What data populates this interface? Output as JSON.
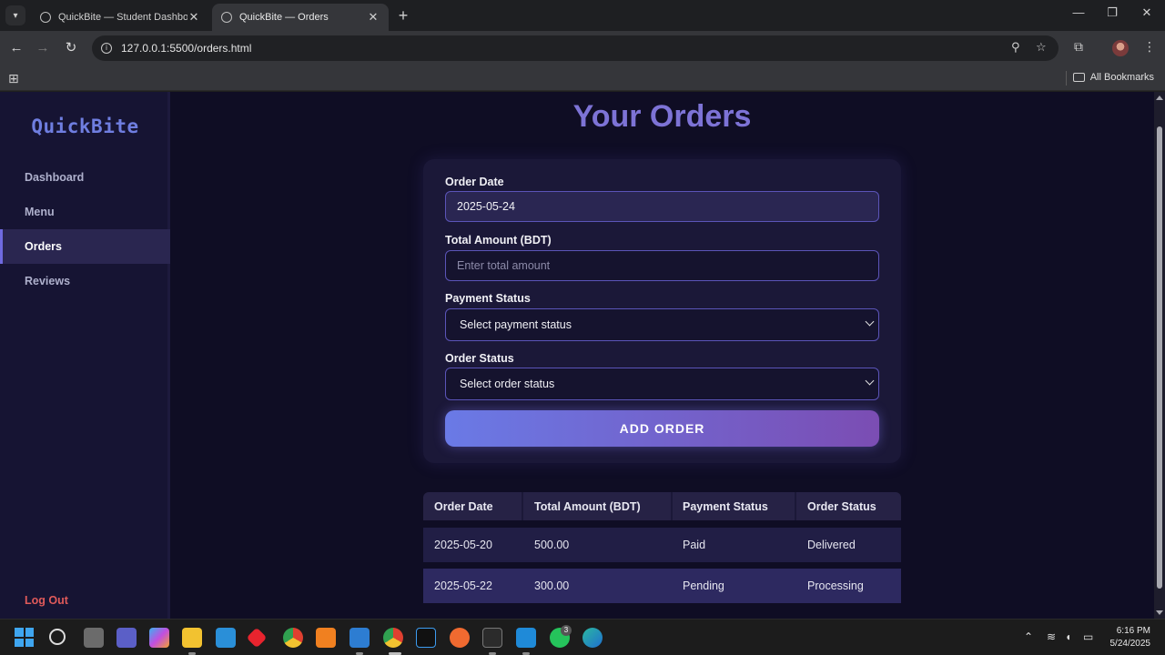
{
  "browser": {
    "tabs": [
      {
        "title": "QuickBite — Student Dashboard",
        "active": false
      },
      {
        "title": "QuickBite — Orders",
        "active": true
      }
    ],
    "url": "127.0.0.1:5500/orders.html",
    "bookmarks_label": "All Bookmarks"
  },
  "sidebar": {
    "brand": "QuickBite",
    "items": [
      {
        "label": "Dashboard",
        "active": false
      },
      {
        "label": "Menu",
        "active": false
      },
      {
        "label": "Orders",
        "active": true
      },
      {
        "label": "Reviews",
        "active": false
      }
    ],
    "logout": "Log Out"
  },
  "main": {
    "title": "Your Orders",
    "form": {
      "order_date_label": "Order Date",
      "order_date_value": "2025-05-24",
      "amount_label": "Total Amount (BDT)",
      "amount_placeholder": "Enter total amount",
      "payment_label": "Payment Status",
      "payment_selected": "Select payment status",
      "order_status_label": "Order Status",
      "order_status_selected": "Select order status",
      "submit_label": "ADD ORDER"
    },
    "table": {
      "headers": [
        "Order Date",
        "Total Amount (BDT)",
        "Payment Status",
        "Order Status"
      ],
      "rows": [
        [
          "2025-05-20",
          "500.00",
          "Paid",
          "Delivered"
        ],
        [
          "2025-05-22",
          "300.00",
          "Pending",
          "Processing"
        ]
      ]
    }
  },
  "taskbar": {
    "time": "6:16 PM",
    "date": "5/24/2025",
    "whatsapp_badge": "3"
  },
  "colors": {
    "accent": "#7d73d6",
    "brand": "#6f7ee0",
    "logout": "#e05a5a",
    "background": "#0f0d24"
  }
}
